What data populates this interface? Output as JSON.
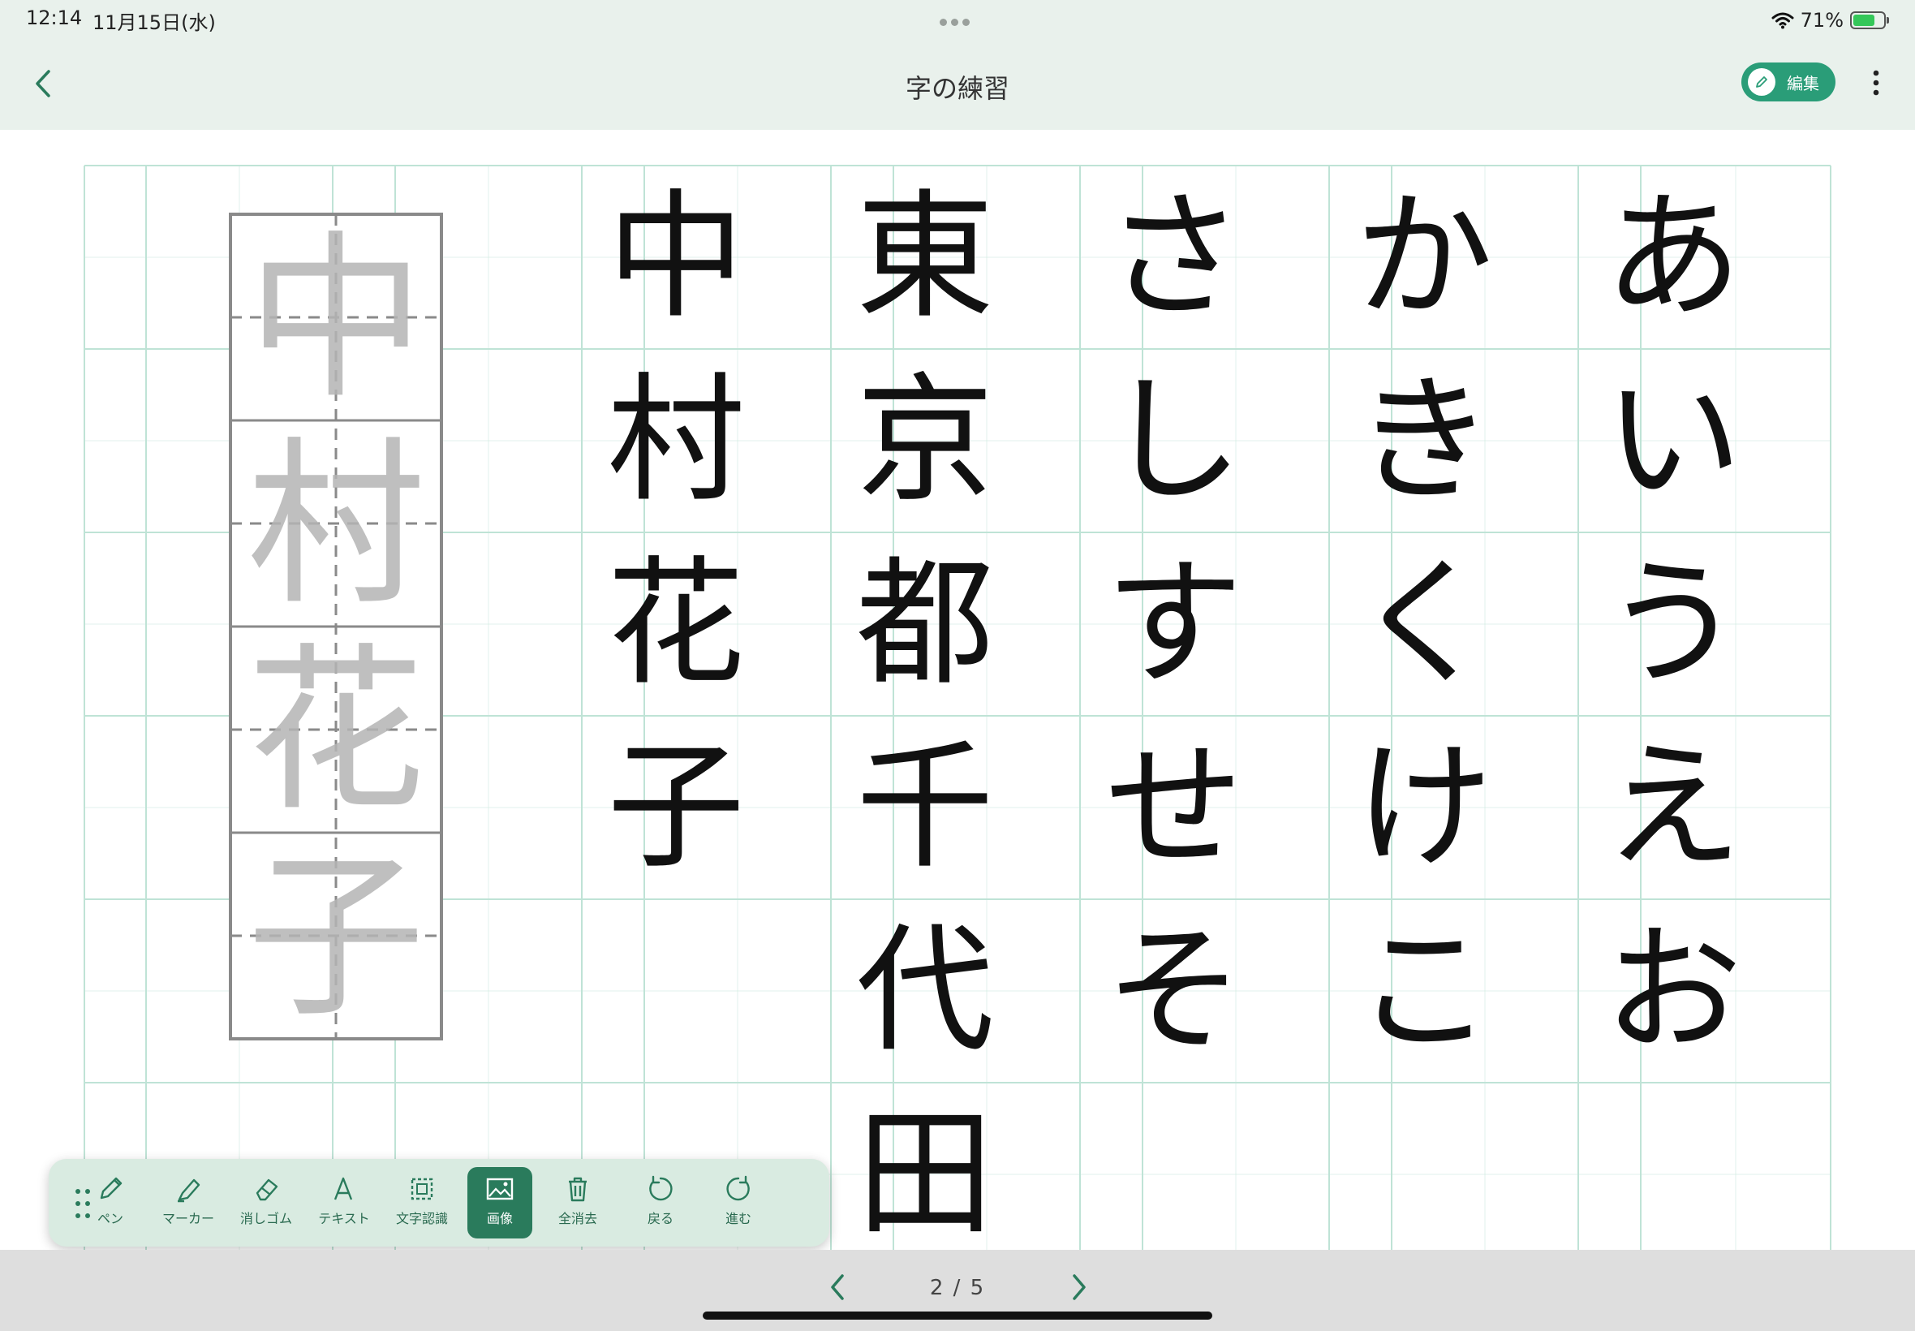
{
  "status": {
    "time": "12:14",
    "date": "11月15日(水)",
    "battery_pct": "71%",
    "battery_level": 0.71,
    "battery_color": "#34c759"
  },
  "header": {
    "title": "字の練習",
    "edit_label": "編集",
    "back_icon": "chevron-left-icon",
    "more_icon": "more-vertical-icon",
    "accent": "#2a9d78",
    "background": "#e9f1ec"
  },
  "sheet": {
    "grid_color": "#bfe3d6",
    "ink_color": "#111111",
    "guide_color": "#b5b5b5",
    "columns": [
      {
        "chars": [
          "あ",
          "い",
          "う",
          "え",
          "お"
        ]
      },
      {
        "chars": [
          "か",
          "き",
          "く",
          "け",
          "こ"
        ]
      },
      {
        "chars": [
          "さ",
          "し",
          "す",
          "せ",
          "そ"
        ]
      },
      {
        "chars": [
          "東",
          "京",
          "都",
          "千",
          "代",
          "田"
        ]
      },
      {
        "chars": [
          "中",
          "村",
          "花",
          "子"
        ]
      }
    ],
    "guide_image": {
      "chars": [
        "中",
        "村",
        "花",
        "子"
      ]
    }
  },
  "toolbar": {
    "tools": [
      {
        "label": "ペン",
        "icon": "pen-icon",
        "active": false
      },
      {
        "label": "マーカー",
        "icon": "marker-icon",
        "active": false
      },
      {
        "label": "消しゴム",
        "icon": "eraser-icon",
        "active": false
      },
      {
        "label": "テキスト",
        "icon": "text-icon",
        "active": false
      },
      {
        "label": "文字認識",
        "icon": "text-recognition-icon",
        "active": false
      },
      {
        "label": "画像",
        "icon": "image-icon",
        "active": true
      },
      {
        "label": "全消去",
        "icon": "trash-icon",
        "active": false
      },
      {
        "label": "戻る",
        "icon": "undo-icon",
        "active": false
      },
      {
        "label": "進む",
        "icon": "redo-icon",
        "active": false
      }
    ]
  },
  "pager": {
    "indicator": "2 / 5",
    "prev_icon": "chevron-left-icon",
    "next_icon": "chevron-right-icon"
  }
}
